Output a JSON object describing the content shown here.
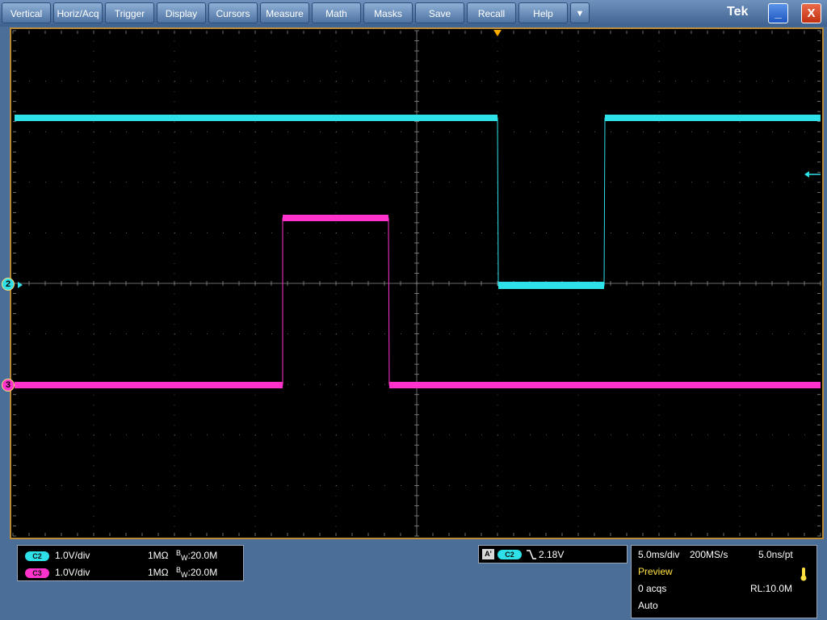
{
  "menu": {
    "items": [
      {
        "label": "Vertical"
      },
      {
        "label": "Horiz/Acq"
      },
      {
        "label": "Trigger"
      },
      {
        "label": "Display"
      },
      {
        "label": "Cursors"
      },
      {
        "label": "Measure"
      },
      {
        "label": "Math"
      },
      {
        "label": "Masks"
      },
      {
        "label": "Save"
      },
      {
        "label": "Recall"
      },
      {
        "label": "Help"
      }
    ],
    "more_label": "▼"
  },
  "window": {
    "brand": "Tek",
    "minimize_label": "_",
    "close_label": "X"
  },
  "colors": {
    "ch2": "#2ee0e8",
    "ch3": "#ff33cc",
    "trigger_marker": "#ffaa00",
    "border": "#b98a3a"
  },
  "markers": {
    "ch2": "2",
    "ch3": "3"
  },
  "channels": [
    {
      "id": "C2",
      "scale": "1.0V/div",
      "impedance": "1MΩ",
      "bw_prefix": "B",
      "bw_sub": "W",
      "bw_value": ":20.0M"
    },
    {
      "id": "C3",
      "scale": "1.0V/div",
      "impedance": "1MΩ",
      "bw_prefix": "B",
      "bw_sub": "W",
      "bw_value": ":20.0M"
    }
  ],
  "trigger": {
    "type_tag": "A'",
    "source": "C2",
    "slope_icon": "falling-edge-icon",
    "level": "2.18V"
  },
  "acquisition": {
    "horizontal_scale": "5.0ms/div",
    "sample_rate": "200MS/s",
    "resolution": "5.0ns/pt",
    "mode": "Preview",
    "acqs": "0 acqs",
    "record_length": "RL:10.0M",
    "trigger_mode": "Auto"
  }
}
